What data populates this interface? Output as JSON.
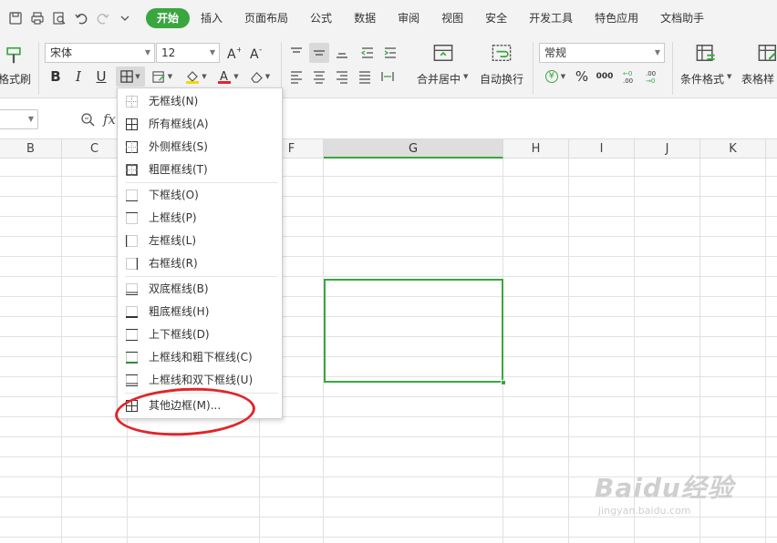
{
  "menubar": {
    "tabs": [
      "开始",
      "插入",
      "页面布局",
      "公式",
      "数据",
      "审阅",
      "视图",
      "安全",
      "开发工具",
      "特色应用",
      "文档助手"
    ],
    "active_tab": "开始",
    "accent_color": "#3aa640"
  },
  "ribbon": {
    "format_painter_label": "格式刷",
    "font_name": "宋体",
    "font_size": "12",
    "merge_center_label": "合并居中",
    "wrap_text_label": "自动换行",
    "number_format": "常规",
    "conditional_format_label": "条件格式",
    "table_style_label": "表格样",
    "bold": "B",
    "italic": "I",
    "underline": "U",
    "currency_symbol": "¥",
    "percent_symbol": "%",
    "thousands_symbol": "000"
  },
  "formula_bar": {
    "fx_label": "fx"
  },
  "grid": {
    "columns": [
      "B",
      "C",
      "F",
      "G",
      "H",
      "I",
      "J",
      "K"
    ],
    "selected_column": "G",
    "selection_color": "#3aa640"
  },
  "border_menu": {
    "items": [
      {
        "label": "无框线(N)",
        "icon": "no-border-icon"
      },
      {
        "label": "所有框线(A)",
        "icon": "all-borders-icon"
      },
      {
        "label": "外侧框线(S)",
        "icon": "outside-borders-icon"
      },
      {
        "label": "粗匣框线(T)",
        "icon": "thick-box-border-icon"
      },
      {
        "label": "下框线(O)",
        "icon": "bottom-border-icon"
      },
      {
        "label": "上框线(P)",
        "icon": "top-border-icon"
      },
      {
        "label": "左框线(L)",
        "icon": "left-border-icon"
      },
      {
        "label": "右框线(R)",
        "icon": "right-border-icon"
      },
      {
        "label": "双底框线(B)",
        "icon": "bottom-double-border-icon"
      },
      {
        "label": "粗底框线(H)",
        "icon": "thick-bottom-border-icon"
      },
      {
        "label": "上下框线(D)",
        "icon": "top-bottom-border-icon"
      },
      {
        "label": "上框线和粗下框线(C)",
        "icon": "top-thick-bottom-border-icon"
      },
      {
        "label": "上框线和双下框线(U)",
        "icon": "top-double-bottom-border-icon"
      },
      {
        "label": "其他边框(M)...",
        "icon": "more-borders-icon"
      }
    ]
  },
  "annotation": {
    "highlight_color": "#e0262a"
  },
  "watermark": {
    "brand": "Baidu经验",
    "url": "jingyan.baidu.com"
  }
}
